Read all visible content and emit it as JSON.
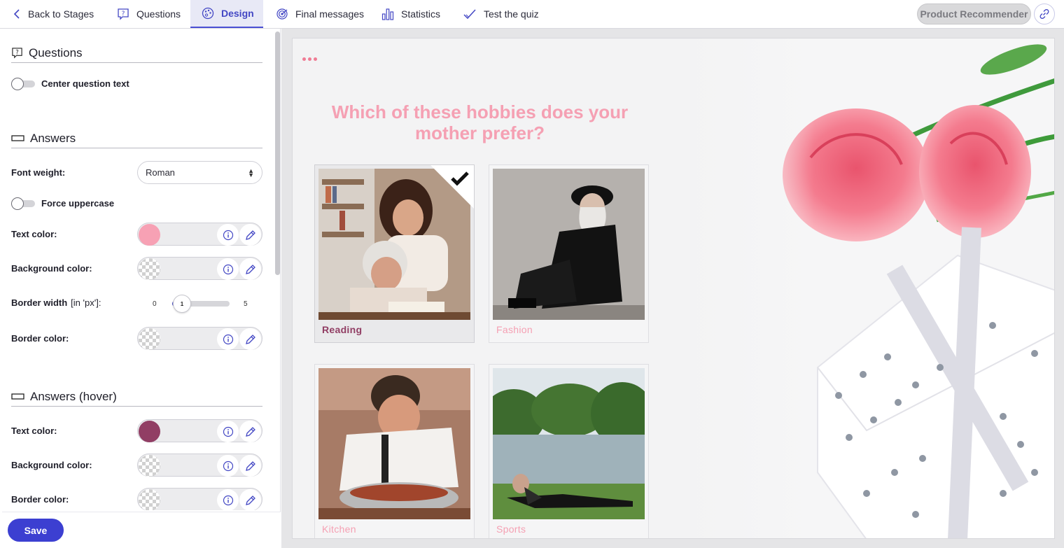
{
  "nav": {
    "back": "Back to Stages",
    "questions": "Questions",
    "design": "Design",
    "final_messages": "Final messages",
    "statistics": "Statistics",
    "test_quiz": "Test the quiz",
    "quiz_name": "Product Recommender"
  },
  "panel": {
    "questions_title": "Questions",
    "center_question_text": "Center question text",
    "answers_title": "Answers",
    "font_weight_label": "Font weight:",
    "font_weight_value": "Roman",
    "force_uppercase": "Force uppercase",
    "text_color_label": "Text color:",
    "background_color_label": "Background color:",
    "border_width_label": "Border width",
    "border_width_unit": "[in 'px']:",
    "border_width_min": "0",
    "border_width_max": "5",
    "border_width_value": "1",
    "border_color_label": "Border color:",
    "answers_hover_title": "Answers (hover)",
    "hover_text_color_label": "Text color:",
    "hover_background_color_label": "Background color:",
    "hover_border_color_label": "Border color:",
    "save": "Save"
  },
  "colors": {
    "answer_text": "#f7a1b4",
    "hover_text": "#913e64",
    "accent": "#3c3fd1"
  },
  "preview": {
    "question": "Which of these hobbies does your mother prefer?",
    "answers": [
      {
        "label": "Reading",
        "selected": true
      },
      {
        "label": "Fashion",
        "selected": false
      },
      {
        "label": "Kitchen",
        "selected": false
      },
      {
        "label": "Sports",
        "selected": false
      }
    ]
  }
}
